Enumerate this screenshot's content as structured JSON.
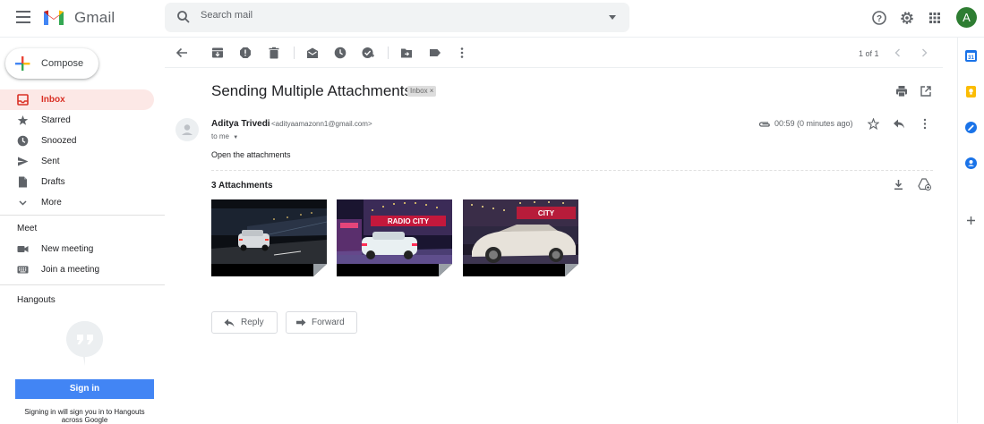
{
  "app": {
    "name": "Gmail"
  },
  "search": {
    "placeholder": "Search mail"
  },
  "compose": {
    "label": "Compose"
  },
  "sidebar": {
    "items": [
      {
        "label": "Inbox",
        "icon": "inbox-icon",
        "active": true
      },
      {
        "label": "Starred",
        "icon": "star-icon"
      },
      {
        "label": "Snoozed",
        "icon": "clock-icon"
      },
      {
        "label": "Sent",
        "icon": "send-icon"
      },
      {
        "label": "Drafts",
        "icon": "draft-icon"
      },
      {
        "label": "More",
        "icon": "chevron-down-icon"
      }
    ],
    "meet": {
      "title": "Meet",
      "items": [
        {
          "label": "New meeting",
          "icon": "video-icon"
        },
        {
          "label": "Join a meeting",
          "icon": "keyboard-icon"
        }
      ]
    },
    "hangouts": {
      "title": "Hangouts",
      "signin_label": "Sign in",
      "note": "Signing in will sign you in to Hangouts across Google"
    }
  },
  "header": {
    "avatar_letter": "A"
  },
  "toolbar": {
    "pager": "1 of 1"
  },
  "message": {
    "subject": "Sending Multiple Attachments",
    "label_tag": "Inbox ×",
    "sender_name": "Aditya Trivedi",
    "sender_email": "<adityaamazonn1@gmail.com>",
    "to": "to me",
    "timestamp": "00:59 (0 minutes ago)",
    "body": "Open the attachments",
    "attachments_title": "3 Attachments",
    "attachments": [
      {
        "name": "car-night-road-thumbnail"
      },
      {
        "name": "car-radio-city-thumbnail"
      },
      {
        "name": "car-radio-city-closeup-thumbnail"
      }
    ]
  },
  "actions": {
    "reply_label": "Reply",
    "forward_label": "Forward"
  },
  "colors": {
    "accent_red": "#d93025",
    "active_bg": "#fce8e6",
    "signin_blue": "#4285f4",
    "avatar_green": "#2e7d32"
  }
}
